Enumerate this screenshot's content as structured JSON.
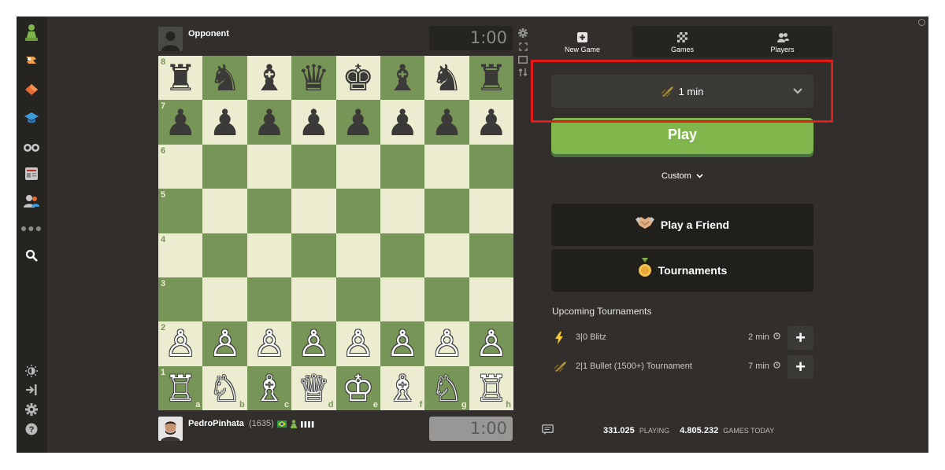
{
  "sidebar": {
    "icons": [
      "pawn-logo-icon",
      "puzzle-icon",
      "lessons-icon",
      "learn-icon",
      "watch-icon",
      "news-icon",
      "social-icon",
      "more-icon",
      "search-icon"
    ],
    "bottom_icons": [
      "theme-icon",
      "collapse-icon",
      "settings-icon",
      "help-icon"
    ]
  },
  "opponent": {
    "name": "Opponent",
    "clock": "1:00"
  },
  "player": {
    "name": "PedroPinhata",
    "rating": "(1635)",
    "clock": "1:00"
  },
  "board": {
    "ranks": [
      "8",
      "7",
      "6",
      "5",
      "4",
      "3",
      "2",
      "1"
    ],
    "files": [
      "a",
      "b",
      "c",
      "d",
      "e",
      "f",
      "g",
      "h"
    ],
    "rows": [
      [
        "♜",
        "♞",
        "♝",
        "♛",
        "♚",
        "♝",
        "♞",
        "♜"
      ],
      [
        "♟",
        "♟",
        "♟",
        "♟",
        "♟",
        "♟",
        "♟",
        "♟"
      ],
      [
        "",
        "",
        "",
        "",
        "",
        "",
        "",
        ""
      ],
      [
        "",
        "",
        "",
        "",
        "",
        "",
        "",
        ""
      ],
      [
        "",
        "",
        "",
        "",
        "",
        "",
        "",
        ""
      ],
      [
        "",
        "",
        "",
        "",
        "",
        "",
        "",
        ""
      ],
      [
        "♙",
        "♙",
        "♙",
        "♙",
        "♙",
        "♙",
        "♙",
        "♙"
      ],
      [
        "♖",
        "♘",
        "♗",
        "♕",
        "♔",
        "♗",
        "♘",
        "♖"
      ]
    ]
  },
  "tabs": [
    {
      "label": "New Game",
      "icon": "plus-square-icon"
    },
    {
      "label": "Games",
      "icon": "board-icon"
    },
    {
      "label": "Players",
      "icon": "users-icon"
    }
  ],
  "time_control": {
    "label": "1 min",
    "icon": "bullet-icon"
  },
  "play_label": "Play",
  "custom_label": "Custom",
  "play_friend_label": "Play a Friend",
  "tournaments_label": "Tournaments",
  "upcoming": {
    "title": "Upcoming Tournaments",
    "items": [
      {
        "name": "3|0 Blitz",
        "time": "2 min",
        "icon": "blitz-icon"
      },
      {
        "name": "2|1 Bullet (1500+) Tournament",
        "time": "7 min",
        "icon": "bullet-icon"
      }
    ]
  },
  "stats": {
    "playing_count": "331.025",
    "playing_label": "PLAYING",
    "games_count": "4.805.232",
    "games_label": "GAMES TODAY"
  },
  "colors": {
    "accent": "#81b64c",
    "light_square": "#ebecd0",
    "dark_square": "#779556",
    "highlight": "#e3191a"
  }
}
